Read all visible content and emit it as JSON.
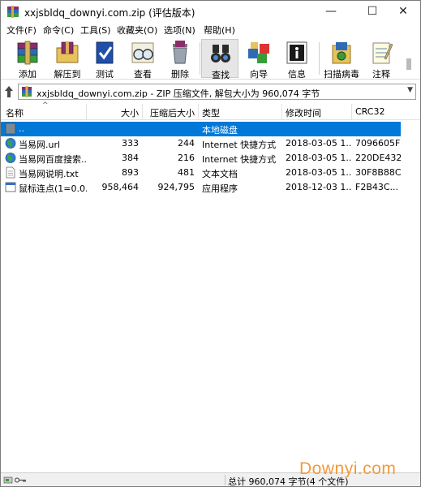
{
  "window": {
    "title": "xxjsbldq_downyi.com.zip (评估版本)",
    "minimize_glyph": "—",
    "maximize_glyph": "☐",
    "close_glyph": "✕"
  },
  "menu": [
    "文件(F)",
    "命令(C)",
    "工具(S)",
    "收藏夹(O)",
    "选项(N)",
    "帮助(H)"
  ],
  "toolbar": [
    {
      "label": "添加",
      "icon": "archive-books-icon"
    },
    {
      "label": "解压到",
      "icon": "folder-extract-icon"
    },
    {
      "label": "测试",
      "icon": "book-check-icon"
    },
    {
      "label": "查看",
      "icon": "glasses-icon"
    },
    {
      "label": "删除",
      "icon": "trash-icon"
    },
    {
      "label": "查找",
      "icon": "binoculars-icon"
    },
    {
      "label": "向导",
      "icon": "wand-icon"
    },
    {
      "label": "信息",
      "icon": "info-icon"
    },
    {
      "label": "扫描病毒",
      "icon": "virus-scan-icon"
    },
    {
      "label": "注释",
      "icon": "notepad-icon"
    }
  ],
  "address": {
    "text": "xxjsbldq_downyi.com.zip - ZIP 压缩文件, 解包大小为 960,074 字节"
  },
  "columns": {
    "name": "名称",
    "size": "大小",
    "packed": "压缩后大小",
    "type": "类型",
    "modified": "修改时间",
    "crc": "CRC32"
  },
  "files": [
    {
      "name": "..",
      "size": "",
      "packed": "",
      "type": "本地磁盘",
      "modified": "",
      "crc": "",
      "icon": "parent-folder-icon",
      "selected": true
    },
    {
      "name": "当易网.url",
      "size": "333",
      "packed": "244",
      "type": "Internet 快捷方式",
      "modified": "2018-03-05 1...",
      "crc": "7096605F",
      "icon": "globe-icon",
      "selected": false
    },
    {
      "name": "当易网百度搜索...",
      "size": "384",
      "packed": "216",
      "type": "Internet 快捷方式",
      "modified": "2018-03-05 1...",
      "crc": "220DE432",
      "icon": "globe-icon",
      "selected": false
    },
    {
      "name": "当易网说明.txt",
      "size": "893",
      "packed": "481",
      "type": "文本文档",
      "modified": "2018-03-05 1...",
      "crc": "30F8B88C",
      "icon": "text-file-icon",
      "selected": false
    },
    {
      "name": "鼠标连点(1=0.0...",
      "size": "958,464",
      "packed": "924,795",
      "type": "应用程序",
      "modified": "2018-12-03 1...",
      "crc": "F2B43C...",
      "icon": "app-window-icon",
      "selected": false
    }
  ],
  "status": {
    "text": "总计 960,074 字节(4 个文件)"
  },
  "watermark": "Downyi.com",
  "colors": {
    "selection": "#0078d7",
    "watermark": "#f39a3a"
  }
}
